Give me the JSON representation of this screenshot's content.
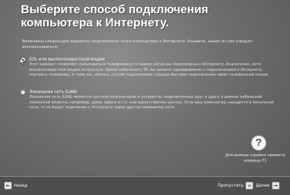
{
  "header": {
    "title": "Выберите способ подключения компьютера к Интернету."
  },
  "intro": "Возможны следующие варианты подключения этого компьютера к Интернету. Укажите, каким из них следует воспользоваться:",
  "options": [
    {
      "label": "DSL или высокоскоростной модем",
      "description": "Этот вариант позволяет пользоваться телефоном в то время, когда вы подключены к Интернету. Аналогично, хотя высокоскоростной модем использует линию кабельного ТВ, вы можете одновременно с подключением к Интернету смотреть телевизор. К тому же, обычно, способ подключения гораздо быстрее подключения через телефонный модем.",
      "selected": true
    },
    {
      "label": "Локальная сеть (LAN)",
      "description": "Локальная сеть (LAN) является группой компьютеров и устройств, подключенных друг к другу в рамках небольшой локальной области, например, дома, офиса и т.п. или одного бизнес-центра. Если ваш компьютер находится в локальной сети, то он будет подключен к Интернету через другой компьютер сети.",
      "selected": false
    }
  ],
  "help": {
    "icon": "question-mark-icon",
    "text": "Для вывода справки нажмите клавишу F1"
  },
  "footer": {
    "back_label": "Назад",
    "skip_label": "Пропустить",
    "next_label": "Далее"
  },
  "colors": {
    "background": "#6e6e6e",
    "footer": "#4e4e4e",
    "text": "#ffffff"
  }
}
